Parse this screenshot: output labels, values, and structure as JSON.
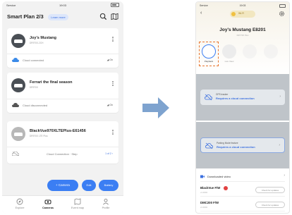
{
  "left_phone": {
    "status": {
      "carrier": "Service",
      "time": "19:03"
    },
    "header": {
      "title": "Smart Plan 2/3",
      "learn_more": "Learn more"
    },
    "cameras": [
      {
        "name": "Joy's Mustang",
        "model": "DR970X-2CH",
        "status": "Cloud connected",
        "gps": "On"
      },
      {
        "name": "Ferrari the final season",
        "model": "DR970X",
        "status": "Cloud disconnected",
        "gps": "On"
      },
      {
        "name": "BlackVue970XLTEPlus-E61456",
        "model": "DR970X LTE Plus",
        "status": "Cloud Connection · Step",
        "step": "1 of 2 ›"
      }
    ],
    "fab": {
      "camera": "+ Camera",
      "edit": "Edit",
      "battery": "Battery"
    },
    "tabs": [
      {
        "label": "Explore"
      },
      {
        "label": "Cameras"
      },
      {
        "label": "Event map"
      },
      {
        "label": "Profile"
      }
    ],
    "active_tab": "Cameras"
  },
  "right_phone": {
    "status": {
      "carrier": "Service",
      "time": "19:03"
    },
    "wifi_pill": "Wi-Fi",
    "camera_name": "Joy's Mustang E8201",
    "camera_model": "DR770X Plus",
    "actions": [
      {
        "label": "Playback"
      },
      {
        "label": "Live View"
      },
      {
        "label": ""
      },
      {
        "label": ""
      }
    ],
    "gps_block": {
      "title": "GPS tracker",
      "cta": "Requires a cloud connection"
    },
    "parking_block": {
      "title": "Parking Mode feature",
      "cta": "Requires a cloud connection"
    },
    "downloaded": "Downloaded video",
    "firmware": [
      {
        "name": "BlackVue F/W",
        "version": "v1.0004",
        "button": "Check for updates"
      },
      {
        "name": "DMC200 F/W",
        "version": "v1.0004",
        "button": "Check for updates"
      }
    ]
  },
  "colors": {
    "accent": "#3b7ef3",
    "highlight": "#e8752d",
    "arrow": "#7ea3cf"
  }
}
